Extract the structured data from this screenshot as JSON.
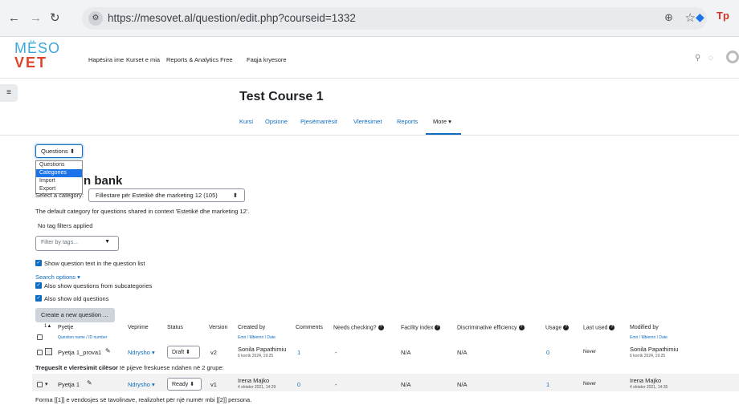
{
  "browser": {
    "url": "https://mesovet.al/question/edit.php?courseid=1332",
    "ext_label": "Tp"
  },
  "navbar": {
    "logo_top": "MËSO",
    "logo_bottom": "VET",
    "links": [
      "Hapësira ime",
      "Kurset e mia",
      "Reports & Analytics Free",
      "Faqja kryesore"
    ]
  },
  "course": {
    "title": "Test Course 1",
    "tabs": [
      "Kursi",
      "Opsione",
      "Pjesëmarrësit",
      "Vlerësimet",
      "Reports",
      "More ▾"
    ]
  },
  "qselect": {
    "value": "Questions",
    "options": [
      "Questions",
      "Categories",
      "Import",
      "Export"
    ]
  },
  "bank_title": "n bank",
  "category": {
    "label": "Select a category:",
    "value": "Fillestare për Estetikë dhe marketing 12 (105)",
    "description": "The default category for questions shared in context 'Estetikë dhe marketing 12'."
  },
  "filters": {
    "no_tags": "No tag filters applied",
    "tags_placeholder": "Filter by tags...",
    "show_text": "Show question text in the question list",
    "search_options": "Search options ▾",
    "subcategories": "Also show questions from subcategories",
    "old_questions": "Also show old questions",
    "create_button": "Create a new question ..."
  },
  "table": {
    "headers": {
      "sort": "1▲",
      "question": "Pyetje",
      "question_sub": "Question name / ID number",
      "actions": "Veprime",
      "status": "Status",
      "version": "Version",
      "created_by": "Created by",
      "created_sub": "Emri / Mbiemri / Date",
      "comments": "Comments",
      "needs_checking": "Needs checking?",
      "facility": "Facility index",
      "discrimination": "Discriminative efficiency",
      "usage": "Usage",
      "last_used": "Last used",
      "modified_by": "Modified by",
      "modified_sub": "Emri / Mbiemri / Date"
    },
    "rows": [
      {
        "name": "Pyetja 1_prova1",
        "action": "Ndrysho ▾",
        "status": "Draft",
        "version": "v2",
        "creator": "Sonila Papathimiu",
        "created_date": "6 korrik 2024, 19:25",
        "comments": "1",
        "needs_checking": "-",
        "facility": "N/A",
        "discrimination": "N/A",
        "usage": "0",
        "last_used": "Never",
        "modifier": "Sonila Papathimiu",
        "modified_date": "6 korrik 2024, 19:25",
        "text_bold": "Tregueslt e vlerësimit cilësor",
        "text_rest": " të pijeve freskuese ndahen në 2 grupe:"
      },
      {
        "name": "Pyetja 1",
        "action": "Ndrysho ▾",
        "status": "Ready",
        "version": "v1",
        "creator": "Irena Majko",
        "created_date": "4 shtator 2021, 14:29",
        "comments": "0",
        "needs_checking": "-",
        "facility": "N/A",
        "discrimination": "N/A",
        "usage": "1",
        "last_used": "Never",
        "modifier": "Irena Majko",
        "modified_date": "4 shtator 2021, 14:35",
        "text": "Forma [[1]] e vendosjes së tavolinave, realizohet për një numër mbi  [[2]] persona."
      }
    ]
  }
}
